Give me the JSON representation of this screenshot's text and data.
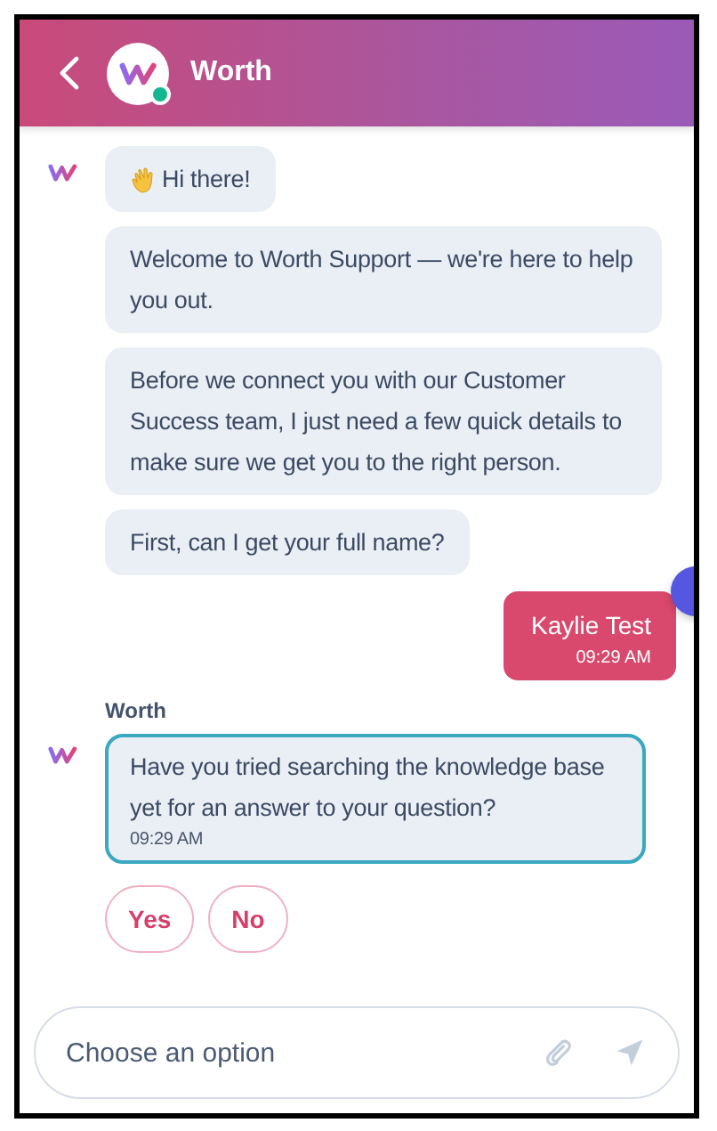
{
  "header": {
    "title": "Worth",
    "online": true
  },
  "threads": [
    {
      "kind": "bot",
      "bubbles": [
        {
          "text": "Hi there!",
          "wave": true,
          "highlighted": false
        },
        {
          "text": "Welcome to Worth Support — we're here to help you out.",
          "wave": false,
          "highlighted": false
        },
        {
          "text": "Before we connect you with our Customer Success team, I just need a few quick details to make sure we get you to the right person.",
          "wave": false,
          "highlighted": false
        },
        {
          "text": "First, can I get your full name?",
          "wave": false,
          "highlighted": false
        }
      ]
    },
    {
      "kind": "user",
      "bubbles": [
        {
          "text": "Kaylie Test",
          "time": "09:29 AM"
        }
      ]
    },
    {
      "kind": "bot",
      "sender": "Worth",
      "bubbles": [
        {
          "text": "Have you tried searching the knowledge base yet for an answer to your question?",
          "time": "09:29 AM",
          "wave": false,
          "highlighted": true
        }
      ]
    }
  ],
  "quick_replies": [
    "Yes",
    "No"
  ],
  "composer": {
    "placeholder": "Choose an option"
  }
}
